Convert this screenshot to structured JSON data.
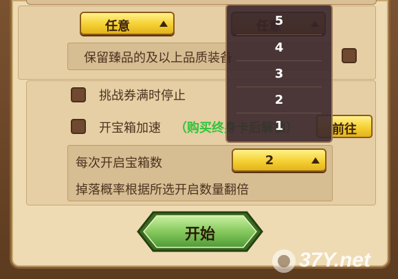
{
  "top_section": {
    "quality_select_value": "任意",
    "right_select_value": "任意",
    "keep_label": "保留臻品的及以上品质装备"
  },
  "options": {
    "ticket_stop_label": "挑战券满时停止",
    "chest_speed_label": "开宝箱加速",
    "chest_speed_hint": "（购买终身卡后解锁）",
    "goto_label": "前往"
  },
  "chest_count": {
    "label": "每次开启宝箱数",
    "selected": "2",
    "note": "掉落概率根据所选开启数量翻倍"
  },
  "start_button": {
    "label": "开始"
  },
  "dropdown": {
    "options": [
      "5",
      "4",
      "3",
      "2",
      "1"
    ]
  },
  "watermark": {
    "text": "37Y.net"
  },
  "colors": {
    "panel": "#eedbb4",
    "button_yellow": "#f5d033",
    "start_green": "#7cc05a",
    "hint_green": "#2fc43a",
    "dropdown_bg": "#3a262c"
  }
}
